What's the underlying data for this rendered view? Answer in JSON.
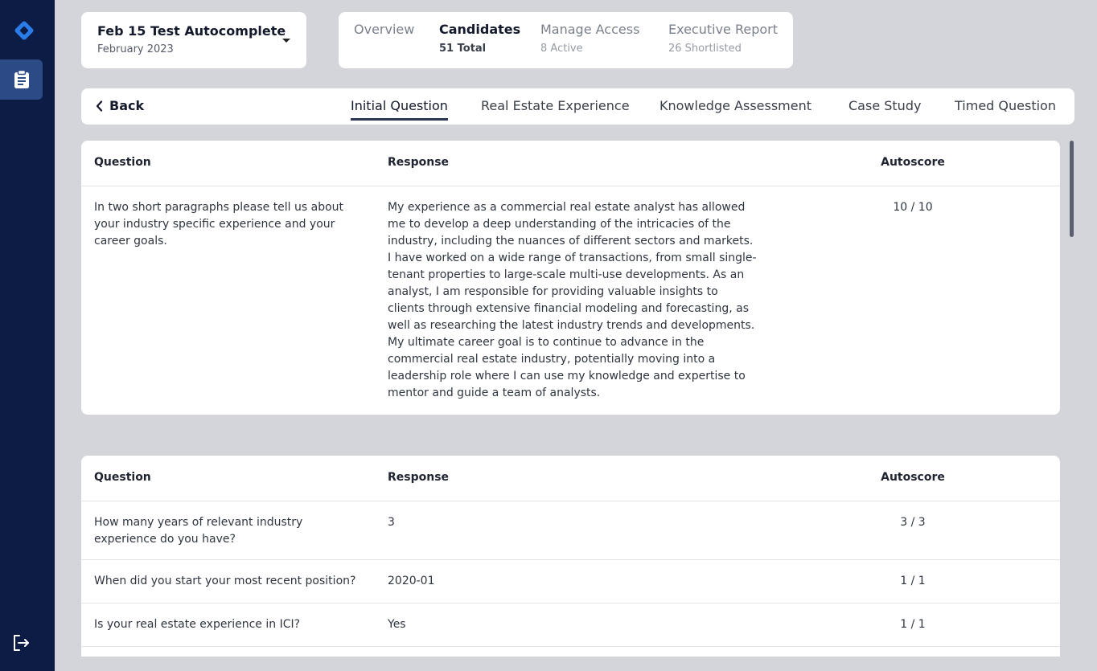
{
  "project": {
    "title": "Feb 15 Test Autocomplete",
    "subtitle": "February 2023"
  },
  "top_tabs": [
    {
      "label": "Overview",
      "sub": ""
    },
    {
      "label": "Candidates",
      "sub": "51 Total"
    },
    {
      "label": "Manage Access",
      "sub": "8 Active"
    },
    {
      "label": "Executive Report",
      "sub": "26 Shortlisted"
    }
  ],
  "back_label": "Back",
  "section_tabs": [
    "Initial Question",
    "Real Estate Experience",
    "Knowledge Assessment",
    "Case Study",
    "Timed Question"
  ],
  "headers": {
    "question": "Question",
    "response": "Response",
    "autoscore": "Autoscore"
  },
  "table1": {
    "rows": [
      {
        "question": "In two short paragraphs please tell us about your industry specific experience and your career goals.",
        "response": "My experience as a commercial real estate analyst has allowed me to develop a deep understanding of the intricacies of the industry, including the nuances of different sectors and markets. I have worked on a wide range of transactions, from small single-tenant properties to large-scale multi-use developments. As an analyst, I am responsible for providing valuable insights to clients through extensive financial modeling and forecasting, as well as researching the latest industry trends and developments. My ultimate career goal is to continue to advance in the commercial real estate industry, potentially moving into a leadership role where I can use my knowledge and expertise to mentor and guide a team of analysts.",
        "score": "10 / 10"
      }
    ]
  },
  "table2": {
    "rows": [
      {
        "question": "How many years of relevant industry experience do you have?",
        "response": "3",
        "score": "3 / 3"
      },
      {
        "question": "When did you start your most recent position?",
        "response": "2020-01",
        "score": "1 / 1"
      },
      {
        "question": "Is your real estate experience in ICI?",
        "response": "Yes",
        "score": "1 / 1"
      }
    ]
  },
  "colors": {
    "sidebar": "#0c1c44",
    "accent": "#2a7ce8",
    "nav_active": "#2c4a86"
  }
}
